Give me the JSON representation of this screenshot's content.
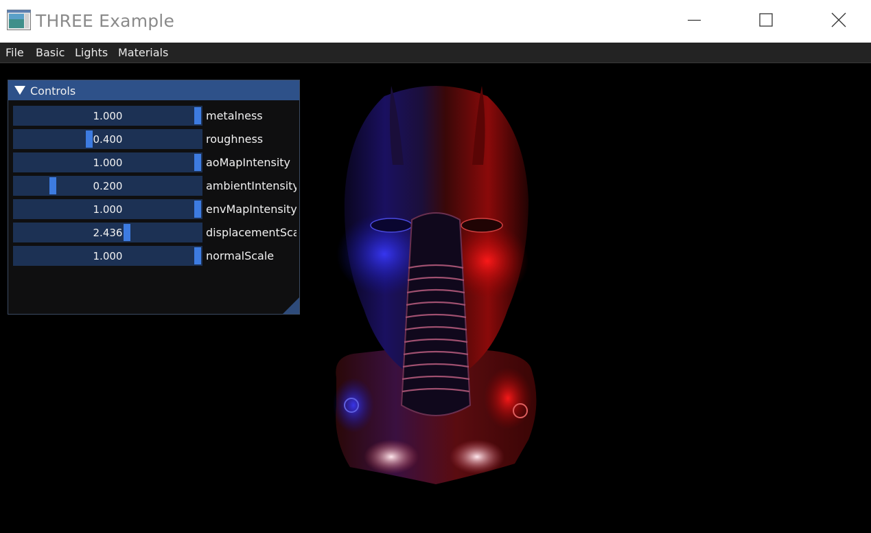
{
  "window": {
    "title": "THREE Example",
    "icon": "app-window-icon",
    "controls": [
      "minimize-icon",
      "maximize-icon",
      "close-icon"
    ]
  },
  "menu": {
    "items": [
      {
        "label": "File"
      },
      {
        "label": "Basic"
      },
      {
        "label": "Lights"
      },
      {
        "label": "Materials"
      }
    ]
  },
  "panel": {
    "title": "Controls",
    "collapse_icon": "triangle-down-icon",
    "sliders": [
      {
        "label": "metalness",
        "value": "1.000",
        "fraction": 1.0
      },
      {
        "label": "roughness",
        "value": "0.400",
        "fraction": 0.4
      },
      {
        "label": "aoMapIntensity",
        "value": "1.000",
        "fraction": 1.0
      },
      {
        "label": "ambientIntensity",
        "value": "0.200",
        "fraction": 0.2
      },
      {
        "label": "envMapIntensity",
        "value": "1.000",
        "fraction": 1.0
      },
      {
        "label": "displacementSca",
        "value": "2.436",
        "fraction": 0.609
      },
      {
        "label": "normalScale",
        "value": "1.000",
        "fraction": 1.0
      }
    ]
  },
  "colors": {
    "accent": "#3d7be0",
    "header": "#2e5189",
    "frame": "#1c3154"
  }
}
